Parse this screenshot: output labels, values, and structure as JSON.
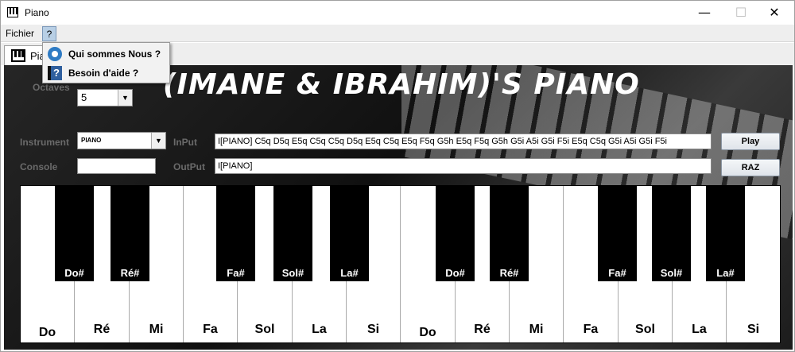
{
  "window": {
    "title": "Piano",
    "controls": {
      "minimize": "—",
      "maximize": "☐",
      "close": "✕"
    }
  },
  "menubar": {
    "items": [
      {
        "label": "Fichier"
      },
      {
        "label": "?"
      }
    ]
  },
  "help_menu": {
    "items": [
      {
        "label": "Qui sommes Nous ?",
        "icon": "people-icon"
      },
      {
        "label": "Besoin d'aide ?",
        "icon": "help-icon"
      }
    ]
  },
  "tab": {
    "label": "Pia"
  },
  "banner": {
    "text": "(IMANE & IBRAHIM)'S PIANO"
  },
  "controls": {
    "octaves_label": "Octaves",
    "octaves_value": "5",
    "instrument_label": "Instrument",
    "instrument_value": "PIANO",
    "input_label": "InPut",
    "input_value": "I[PIANO] C5q D5q E5q C5q C5q D5q E5q C5q E5q F5q G5h E5q F5q G5h G5i A5i G5i F5i E5q C5q G5i A5i G5i F5i",
    "console_label": "Console",
    "console_value": "",
    "output_label": "OutPut",
    "output_value": "I[PIANO]",
    "play_button": "Play",
    "reset_button": "RAZ"
  },
  "piano": {
    "white_keys": [
      "Do",
      "Ré",
      "Mi",
      "Fa",
      "Sol",
      "La",
      "Si",
      "Do",
      "Ré",
      "Mi",
      "Fa",
      "Sol",
      "La",
      "Si"
    ],
    "black_keys": [
      "Do#",
      "Ré#",
      "Fa#",
      "Sol#",
      "La#",
      "Do#",
      "Ré#",
      "Fa#",
      "Sol#",
      "La#"
    ]
  },
  "colors": {
    "menu_highlight": "#b8cfe5",
    "label_gray": "#6a6a6a",
    "black_key": "#000000",
    "white_key": "#ffffff"
  }
}
